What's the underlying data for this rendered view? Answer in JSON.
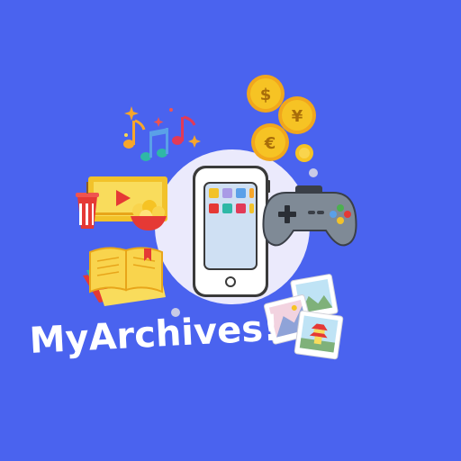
{
  "app": {
    "title": "MyArchives!"
  },
  "colors": {
    "background": "#4a63ef",
    "halo": "#ebeafc",
    "coin": "#f6c324",
    "controller": "#7f8a96"
  },
  "icons": [
    "music-notes-icon",
    "coins-icon",
    "video-player-icon",
    "popcorn-icon",
    "smartphone-icon",
    "game-controller-icon",
    "books-icon",
    "photos-icon"
  ]
}
